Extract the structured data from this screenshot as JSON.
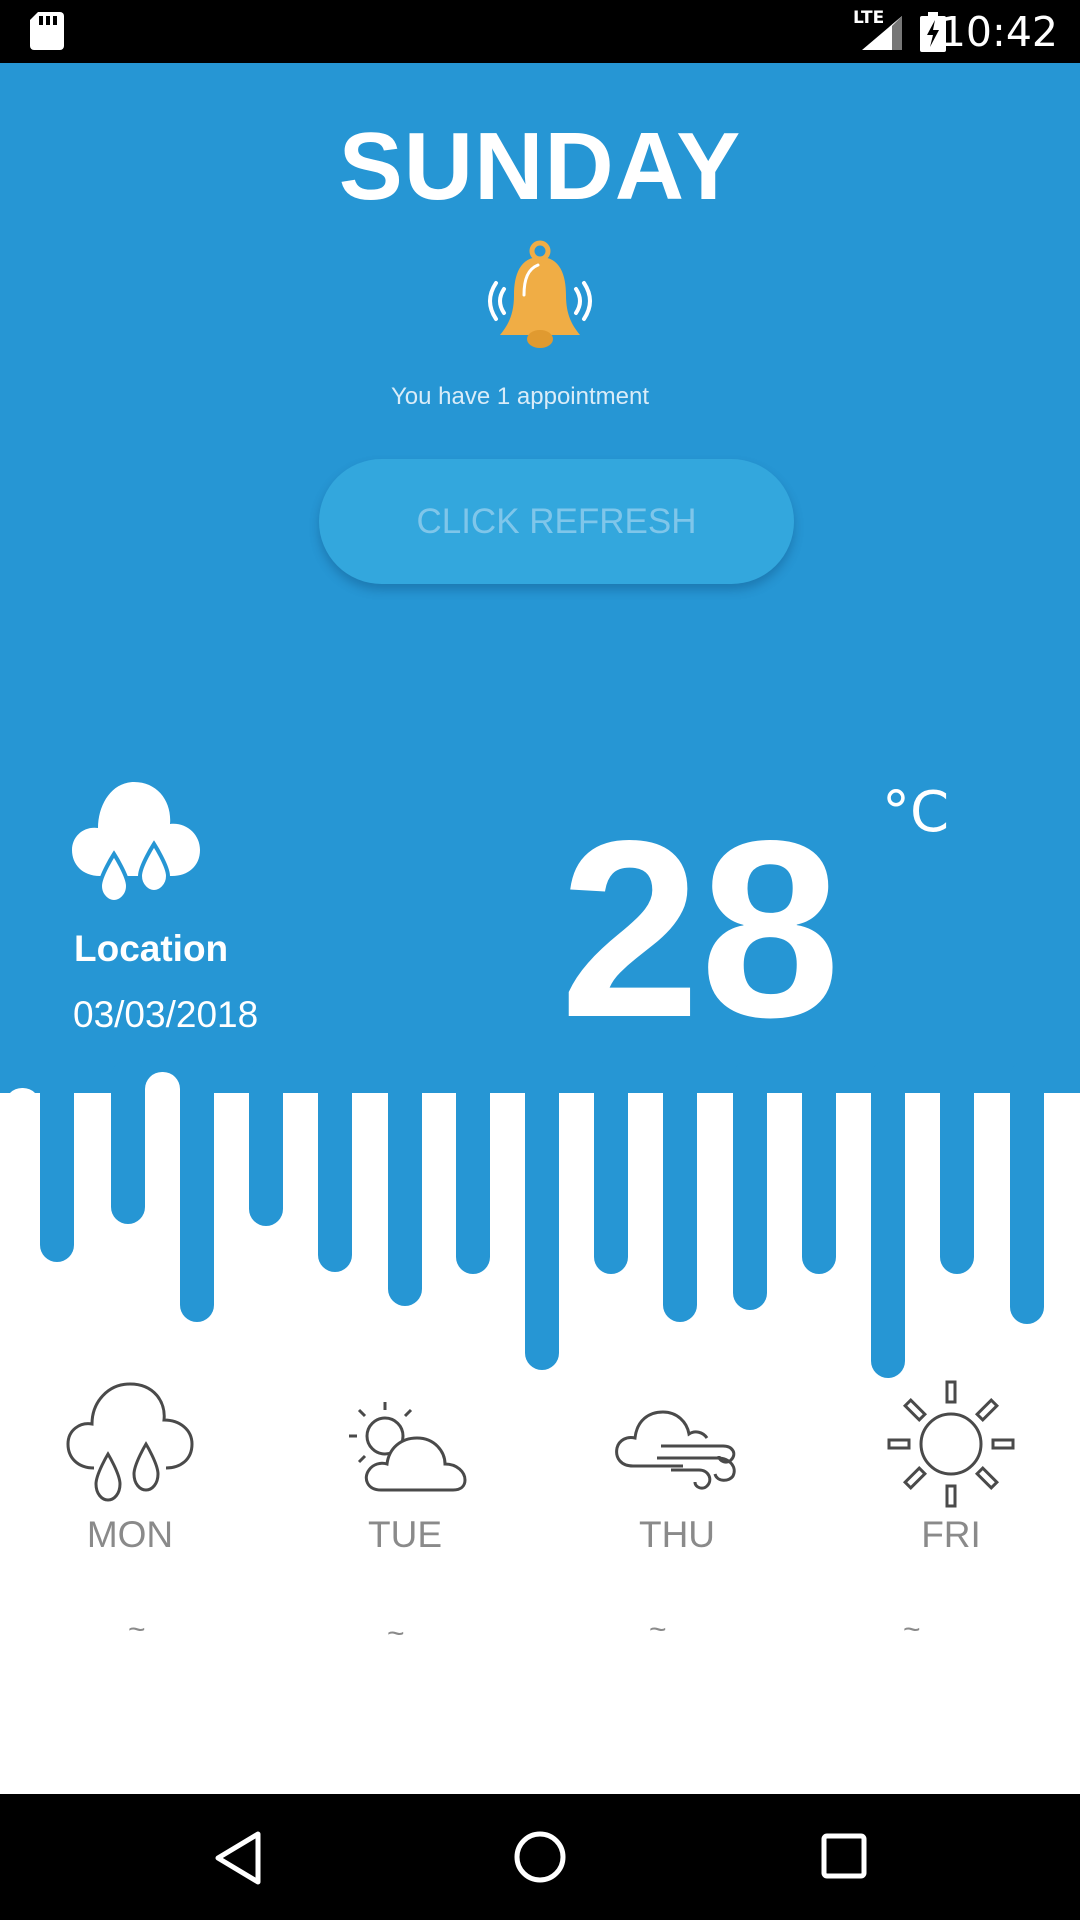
{
  "status_bar": {
    "time": "10:42",
    "network": "LTE"
  },
  "header": {
    "day": "SUNDAY",
    "appointment_text": "You have 1 appointment",
    "refresh_label": "CLICK REFRESH"
  },
  "current": {
    "location": "Location",
    "date": "03/03/2018",
    "temperature": "28",
    "unit": "°C",
    "icon": "rain-cloud-icon"
  },
  "forecast": [
    {
      "day": "MON",
      "temp": "~",
      "icon": "rain-cloud-icon"
    },
    {
      "day": "TUE",
      "temp": "~",
      "icon": "partly-sunny-icon"
    },
    {
      "day": "THU",
      "temp": "~",
      "icon": "windy-cloud-icon"
    },
    {
      "day": "FRI",
      "temp": "~",
      "icon": "sun-icon"
    }
  ],
  "colors": {
    "primary_blue": "#2696d4",
    "button_blue": "#33a7dd",
    "bell_orange": "#f0ad45",
    "forecast_gray": "#8a8a8a"
  },
  "nav": {
    "back": "back-icon",
    "home": "home-icon",
    "recents": "recents-icon"
  }
}
